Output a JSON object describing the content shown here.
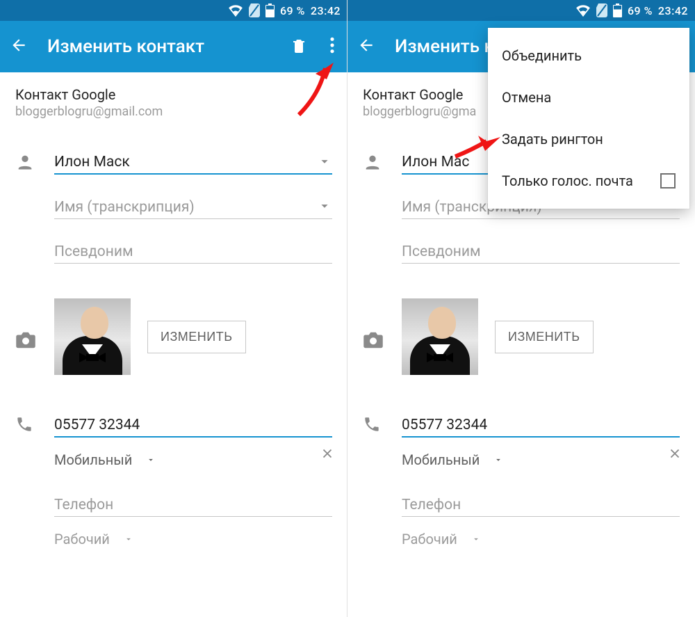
{
  "status": {
    "battery": "69 %",
    "time": "23:42"
  },
  "appbar": {
    "title": "Изменить контакт"
  },
  "account": {
    "label": "Контакт Google",
    "email": "bloggerblogru@gmail.com"
  },
  "name_section": {
    "name_value": "Илон Маск",
    "name_truncated": "Илон Мас",
    "transcription_placeholder": "Имя (транскрипция)",
    "nickname_placeholder": "Псевдоним"
  },
  "photo": {
    "change_button": "ИЗМЕНИТЬ"
  },
  "phone": {
    "value": "05577 32344",
    "type_mobile": "Мобильный",
    "extra_placeholder": "Телефон",
    "type_work": "Рабочий"
  },
  "menu": {
    "merge": "Объединить",
    "cancel": "Отмена",
    "set_ringtone": "Задать рингтон",
    "voicemail_only": "Только голос. почта"
  }
}
